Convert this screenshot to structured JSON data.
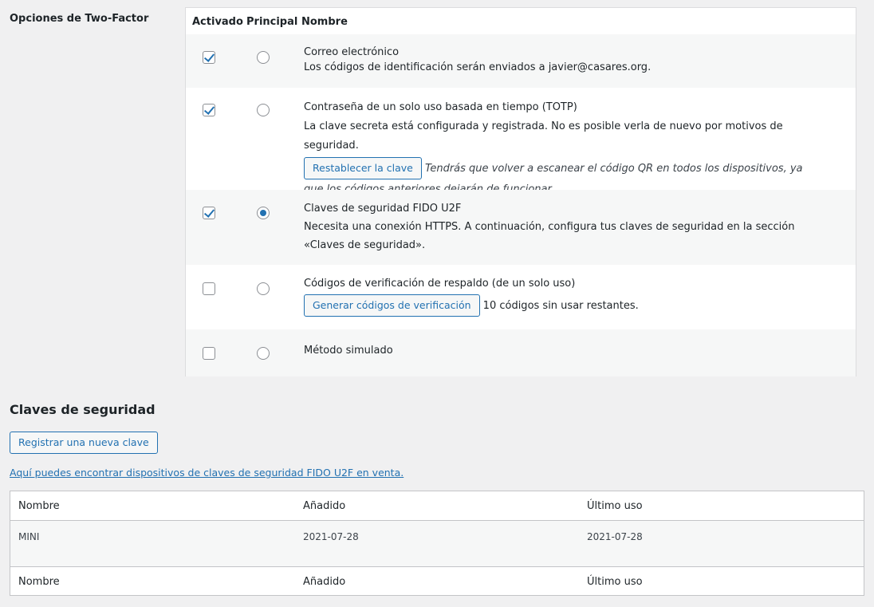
{
  "two_factor": {
    "section_label": "Opciones de Two-Factor",
    "headers": {
      "enabled": "Activado",
      "primary": "Principal",
      "name": "Nombre"
    },
    "email": {
      "title": "Correo electrónico",
      "desc": "Los códigos de identificación serán enviados a javier@casares.org."
    },
    "totp": {
      "title": "Contraseña de un solo uso basada en tiempo (TOTP)",
      "desc": "La clave secreta está configurada y registrada. No es posible verla de nuevo por motivos de seguridad.",
      "reset_button": "Restablecer la clave",
      "note": "Tendrás que volver a escanear el código QR en todos los dispositivos, ya que los códigos anteriores dejarán de funcionar."
    },
    "fido": {
      "title": "Claves de seguridad FIDO U2F",
      "desc": "Necesita una conexión HTTPS. A continuación, configura tus claves de seguridad en la sección «Claves de seguridad»."
    },
    "backup": {
      "title": "Códigos de verificación de respaldo (de un solo uso)",
      "generate_button": "Generar códigos de verificación",
      "remaining": "10 códigos sin usar restantes."
    },
    "dummy": {
      "title": "Método simulado"
    }
  },
  "security_keys": {
    "title": "Claves de seguridad",
    "register_button": "Registrar una nueva clave",
    "link_text": "Aquí puedes encontrar dispositivos de claves de seguridad FIDO U2F en venta.",
    "columns": {
      "name": "Nombre",
      "added": "Añadido",
      "last_used": "Último uso"
    },
    "rows": [
      {
        "name": "MINI",
        "added": "2021-07-28",
        "last_used": "2021-07-28"
      }
    ]
  },
  "colors": {
    "accent": "#2271b1",
    "background": "#f0f0f1"
  }
}
